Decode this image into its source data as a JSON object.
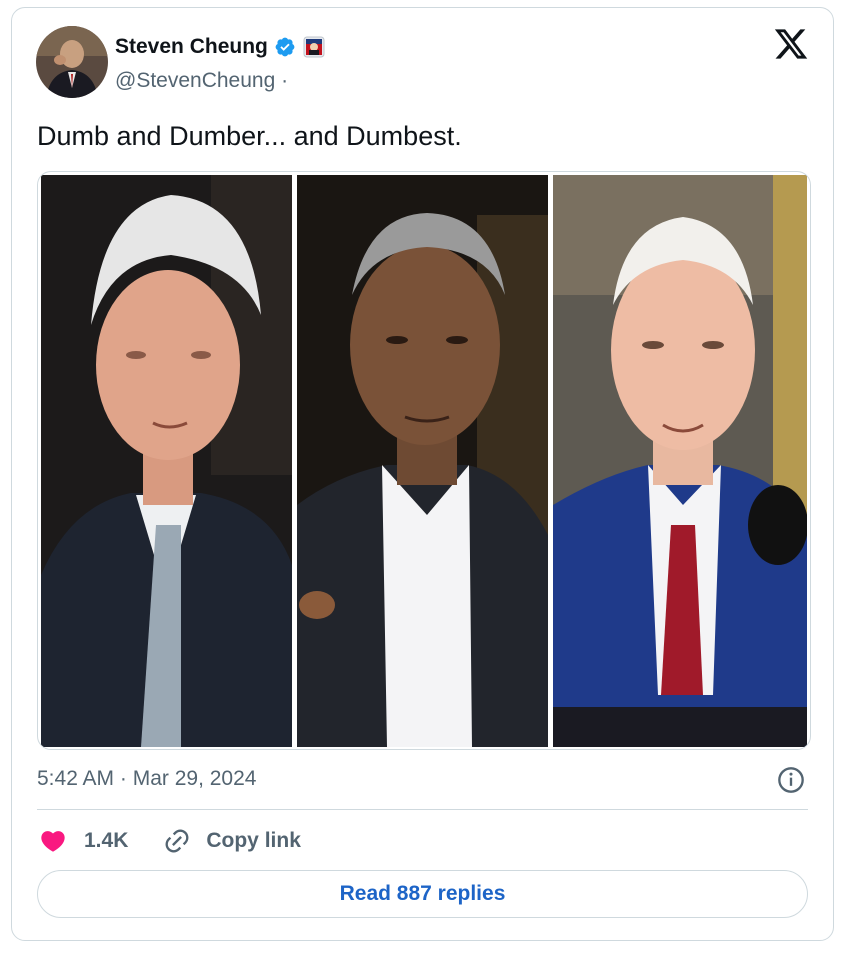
{
  "author": {
    "name": "Steven Cheung",
    "handle": "@StevenCheung",
    "handle_separator": "·",
    "verified": true,
    "avatar_icon": "profile-photo",
    "affiliation_icon": "affiliation-badge-icon"
  },
  "platform_logo": "x-logo-icon",
  "tweet": {
    "text": "Dumb and Dumber... and Dumbest."
  },
  "media": {
    "photos": [
      {
        "icon": "photo-1"
      },
      {
        "icon": "photo-2"
      },
      {
        "icon": "photo-3"
      }
    ]
  },
  "meta": {
    "timestamp": "5:42 AM · Mar 29, 2024",
    "info_icon": "info-icon"
  },
  "actions": {
    "like_count": "1.4K",
    "copy_link_label": "Copy link",
    "read_replies_label": "Read 887 replies"
  },
  "colors": {
    "text_primary": "#0f1419",
    "text_secondary": "#536471",
    "like": "#f91880",
    "verified": "#1d9bf0",
    "link_blue": "#1d64c7",
    "border": "#cfd9de"
  }
}
